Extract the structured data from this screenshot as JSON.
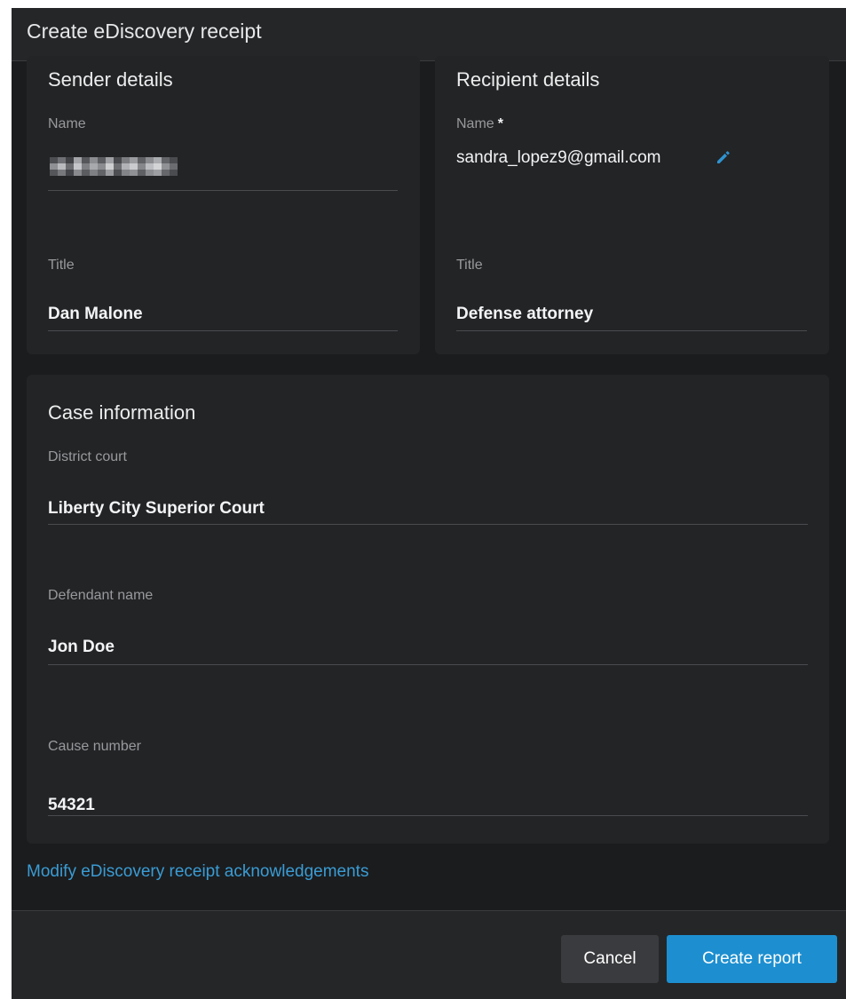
{
  "dialog": {
    "title": "Create eDiscovery receipt"
  },
  "sender": {
    "heading": "Sender details",
    "name_label": "Name",
    "title_label": "Title",
    "title_value": "Dan Malone"
  },
  "recipient": {
    "heading": "Recipient details",
    "name_label": "Name",
    "required_mark": "*",
    "name_value": "sandra_lopez9@gmail.com",
    "title_label": "Title",
    "title_value": "Defense attorney"
  },
  "case": {
    "heading": "Case information",
    "court_label": "District court",
    "court_value": "Liberty City Superior Court",
    "defendant_label": "Defendant name",
    "defendant_value": "Jon Doe",
    "cause_label": "Cause number",
    "cause_value": "54321"
  },
  "links": {
    "modify_ack": "Modify eDiscovery receipt acknowledgements"
  },
  "footer": {
    "cancel_label": "Cancel",
    "create_label": "Create report"
  },
  "icons": {
    "edit": "pencil-icon"
  },
  "colors": {
    "accent": "#1d8fd0",
    "link": "#3a9cd4",
    "background": "#1e1f21"
  }
}
